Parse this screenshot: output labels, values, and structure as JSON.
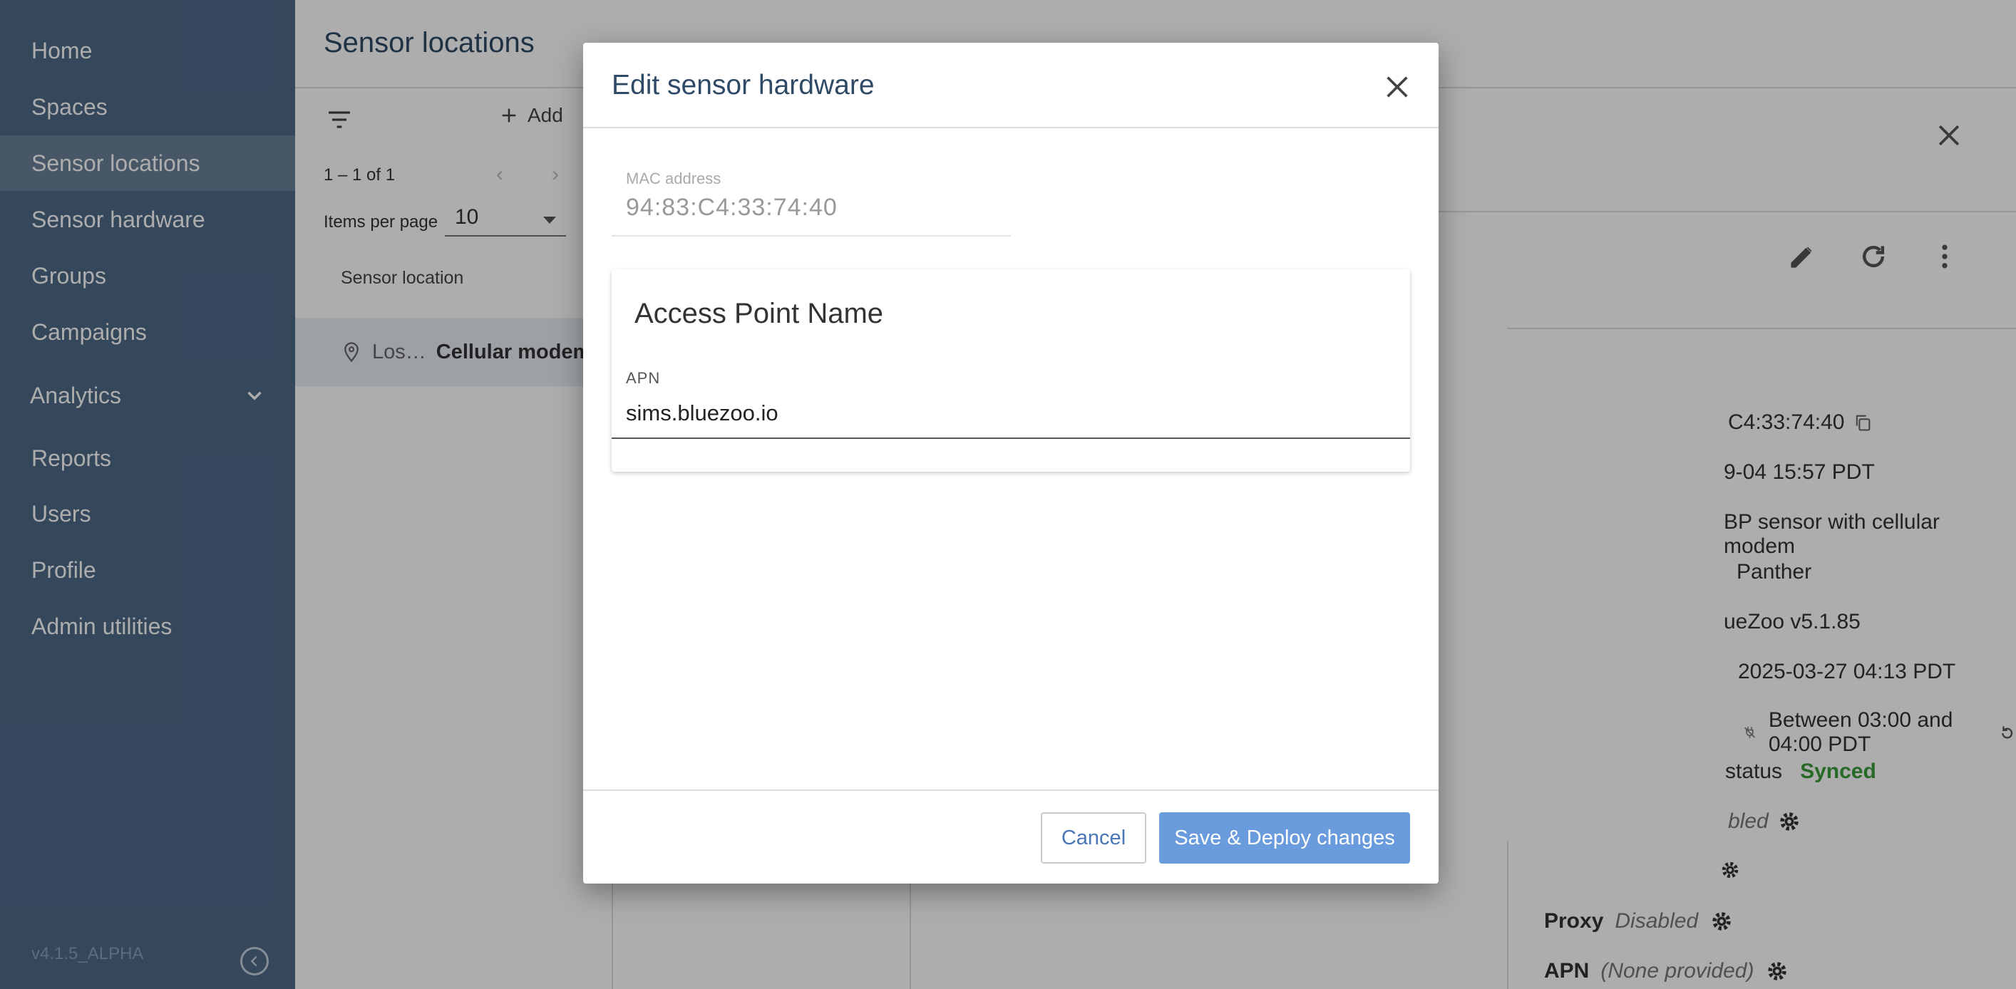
{
  "sidebar": {
    "items": [
      {
        "label": "Home"
      },
      {
        "label": "Spaces"
      },
      {
        "label": "Sensor locations"
      },
      {
        "label": "Sensor hardware"
      },
      {
        "label": "Groups"
      },
      {
        "label": "Campaigns"
      },
      {
        "label": "Analytics"
      },
      {
        "label": "Reports"
      },
      {
        "label": "Users"
      },
      {
        "label": "Profile"
      },
      {
        "label": "Admin utilities"
      }
    ],
    "active_item": "Sensor locations",
    "version": "v4.1.5_ALPHA"
  },
  "header": {
    "title": "Sensor locations"
  },
  "list": {
    "add_label": "Add",
    "range": "1 – 1 of 1",
    "items_per_page_label": "Items per page",
    "items_per_page_value": "10",
    "column_header": "Sensor location",
    "rows": [
      {
        "location": "Los…",
        "type": "Cellular modem"
      }
    ]
  },
  "detail": {
    "values": {
      "mac": "C4:33:74:40",
      "date": "9-04 15:57 PDT",
      "description": "BP sensor with cellular modem",
      "model": "Panther",
      "firmware": "ueZoo v5.1.85",
      "last_seen": "2025-03-27 04:13 PDT",
      "schedule": "Between 03:00 and 04:00 PDT",
      "status_label": "status",
      "status_value": "Synced",
      "disabled_partial": "bled",
      "proxy_label": "Proxy",
      "proxy_value": "Disabled",
      "apn_label": "APN",
      "apn_value": "(None provided)"
    }
  },
  "dialog": {
    "title": "Edit sensor hardware",
    "mac_label": "MAC address",
    "mac_value": "94:83:C4:33:74:40",
    "card_title": "Access Point Name",
    "apn_label": "APN",
    "apn_value": "sims.bluezoo.io",
    "cancel_label": "Cancel",
    "save_label": "Save & Deploy changes"
  },
  "colors": {
    "sidebar": "#4e6987",
    "sidebar_active": "#6b8199",
    "primary_button": "#6a9bdc",
    "title": "#2f4a66",
    "synced": "#3a9b3a"
  }
}
